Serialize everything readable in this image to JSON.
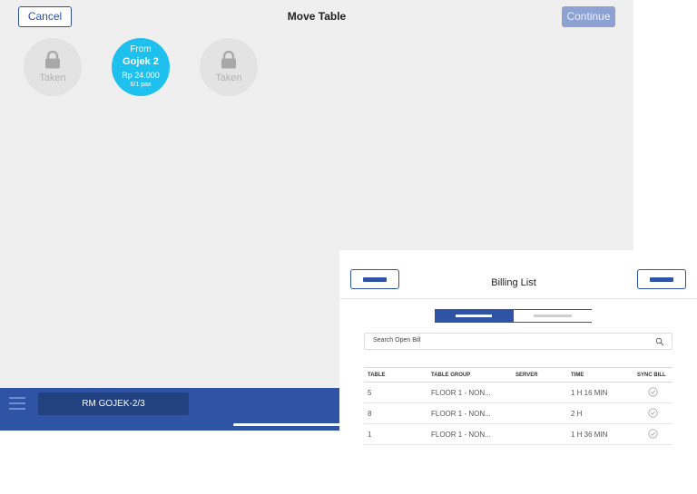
{
  "move_table": {
    "cancel_label": "Cancel",
    "title": "Move Table",
    "continue_label": "Continue",
    "tables": [
      {
        "status": "Taken",
        "icon": "lock-icon"
      },
      {
        "status": "current",
        "from_label": "From",
        "name": "Gojek 2",
        "amount": "Rp 24.000",
        "pax": "6/1 pax"
      },
      {
        "status": "Taken",
        "icon": "lock-icon"
      }
    ]
  },
  "bottom_bar": {
    "menu_icon": "hamburger-icon",
    "order_tab_label": "RM GOJEK-2/3"
  },
  "billing_list": {
    "title": "Billing List",
    "search_placeholder": "Search Open Bill",
    "search_icon": "search-icon",
    "columns": [
      "TABLE",
      "TABLE GROUP",
      "SERVER",
      "TIME",
      "SYNC BILL"
    ],
    "rows": [
      {
        "table": "5",
        "group": "FLOOR 1 - NON...",
        "server": "",
        "time": "1 H 16 MIN",
        "sync_icon": "check-circle-icon"
      },
      {
        "table": "8",
        "group": "FLOOR 1 - NON...",
        "server": "",
        "time": "2 H",
        "sync_icon": "check-circle-icon"
      },
      {
        "table": "1",
        "group": "FLOOR 1 - NON...",
        "server": "",
        "time": "1 H 36 MIN",
        "sync_icon": "check-circle-icon"
      }
    ]
  },
  "colors": {
    "brand_blue": "#2f53a5",
    "current_table": "#1ec0ee",
    "continue_disabled": "#8da2d2"
  }
}
